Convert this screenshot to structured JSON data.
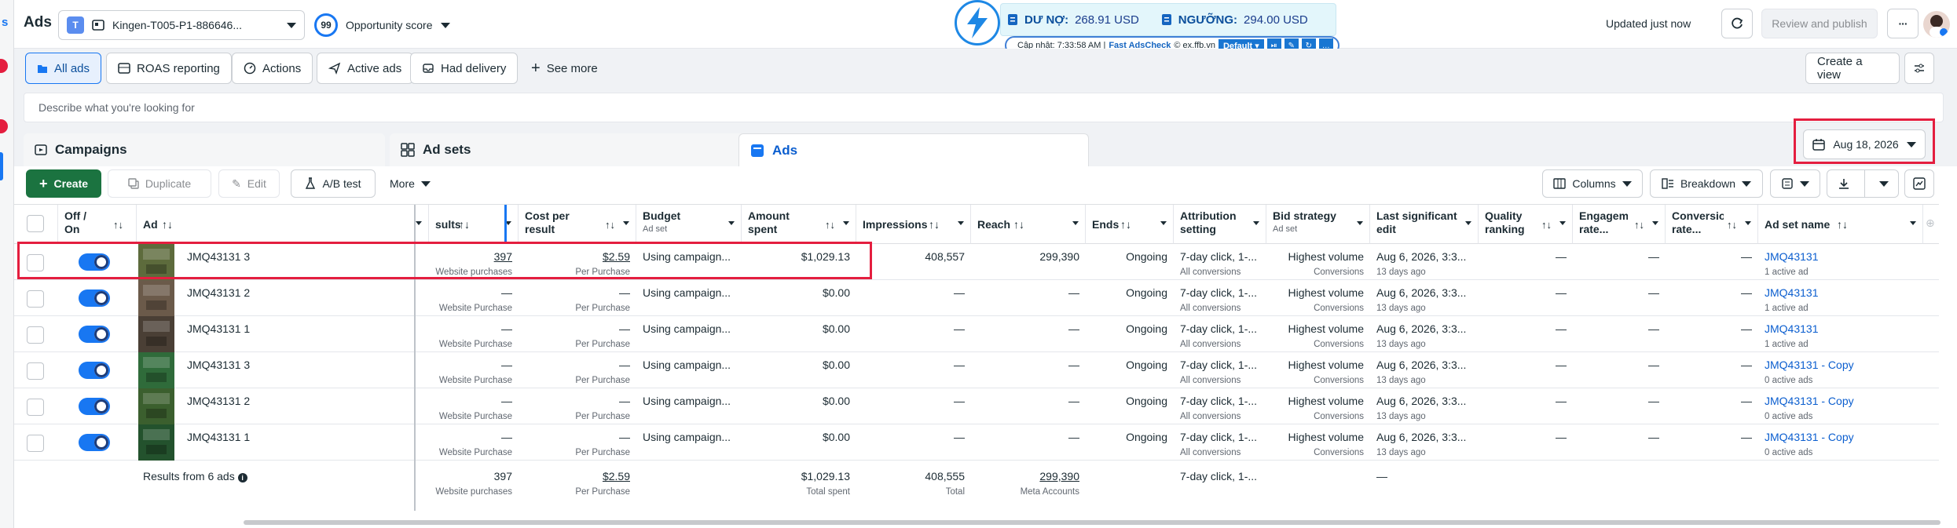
{
  "app": {
    "title": "Ads",
    "account": {
      "avatar_letter": "T",
      "name": "Kingen-T005-P1-886646..."
    },
    "opportunity": {
      "score": "99",
      "label": "Opportunity score"
    },
    "updated": "Updated just now",
    "review_publish": "Review and publish",
    "more_dots": "···"
  },
  "debt_widget": {
    "debt_label": "DƯ NỢ:",
    "debt_value": "268.91 USD",
    "threshold_label": "NGƯỠNG:",
    "threshold_value": "294.00 USD",
    "updated_text": "Cập nhật: 7:33:58 AM |",
    "brand": "Fast AdsCheck",
    "brand_suffix": "© ex.ffb.vn",
    "default_label": "Default"
  },
  "filters": {
    "pills": [
      "All ads",
      "ROAS reporting",
      "Actions",
      "Active ads",
      "Had delivery"
    ],
    "see_more": "See more",
    "create_view": "Create a view",
    "search_placeholder": "Describe what you're looking for"
  },
  "levels": {
    "campaigns": "Campaigns",
    "adsets": "Ad sets",
    "ads": "Ads",
    "date": "Aug 18, 2026"
  },
  "toolbar": {
    "create": "Create",
    "duplicate": "Duplicate",
    "edit": "Edit",
    "ab_test": "A/B test",
    "more": "More",
    "columns": "Columns",
    "breakdown": "Breakdown"
  },
  "columns": {
    "offon": "Off / On",
    "ad": "Ad",
    "results": "sults",
    "cost_per_result": "Cost per result",
    "budget": "Budget",
    "budget_sub": "Ad set",
    "amount_spent": "Amount spent",
    "impressions": "Impressions",
    "reach": "Reach",
    "ends": "Ends",
    "attribution": "Attribution setting",
    "bid_strategy": "Bid strategy",
    "bid_sub": "Ad set",
    "last_edit": "Last significant edit",
    "quality": "Quality ranking",
    "engagement": "Engagement rate...",
    "conversion": "Conversion rate...",
    "adset_name": "Ad set name"
  },
  "rows": [
    {
      "name": "JMQ43131 3",
      "results": "397",
      "results_sub": "Website purchases",
      "cpr": "$2.59",
      "cpr_sub": "Per Purchase",
      "budget": "Using campaign...",
      "spent": "$1,029.13",
      "impr": "408,557",
      "reach": "299,390",
      "ends": "Ongoing",
      "attr": "7-day click, 1-...",
      "attr_sub": "All conversions",
      "bid": "Highest volume",
      "bid_sub": "Conversions",
      "edit": "Aug 6, 2026, 3:3...",
      "edit_sub": "13 days ago",
      "quality": "—",
      "eng": "—",
      "conv": "—",
      "adset": "JMQ43131",
      "adset_sub": "1 active ad",
      "thumb": "#5d6b3c"
    },
    {
      "name": "JMQ43131 2",
      "results": "—",
      "results_sub": "Website Purchase",
      "cpr": "—",
      "cpr_sub": "Per Purchase",
      "budget": "Using campaign...",
      "spent": "$0.00",
      "impr": "—",
      "reach": "—",
      "ends": "Ongoing",
      "attr": "7-day click, 1-...",
      "attr_sub": "All conversions",
      "bid": "Highest volume",
      "bid_sub": "Conversions",
      "edit": "Aug 6, 2026, 3:3...",
      "edit_sub": "13 days ago",
      "quality": "—",
      "eng": "—",
      "conv": "—",
      "adset": "JMQ43131",
      "adset_sub": "1 active ad",
      "thumb": "#6b5a4a"
    },
    {
      "name": "JMQ43131 1",
      "results": "—",
      "results_sub": "Website Purchase",
      "cpr": "—",
      "cpr_sub": "Per Purchase",
      "budget": "Using campaign...",
      "spent": "$0.00",
      "impr": "—",
      "reach": "—",
      "ends": "Ongoing",
      "attr": "7-day click, 1-...",
      "attr_sub": "All conversions",
      "bid": "Highest volume",
      "bid_sub": "Conversions",
      "edit": "Aug 6, 2026, 3:3...",
      "edit_sub": "13 days ago",
      "quality": "—",
      "eng": "—",
      "conv": "—",
      "adset": "JMQ43131",
      "adset_sub": "1 active ad",
      "thumb": "#4a3f35"
    },
    {
      "name": "JMQ43131 3",
      "results": "—",
      "results_sub": "Website Purchase",
      "cpr": "—",
      "cpr_sub": "Per Purchase",
      "budget": "Using campaign...",
      "spent": "$0.00",
      "impr": "—",
      "reach": "—",
      "ends": "Ongoing",
      "attr": "7-day click, 1-...",
      "attr_sub": "All conversions",
      "bid": "Highest volume",
      "bid_sub": "Conversions",
      "edit": "Aug 6, 2026, 3:3...",
      "edit_sub": "13 days ago",
      "quality": "—",
      "eng": "—",
      "conv": "—",
      "adset": "JMQ43131 - Copy",
      "adset_sub": "0 active ads",
      "thumb": "#2f6b3a"
    },
    {
      "name": "JMQ43131 2",
      "results": "—",
      "results_sub": "Website Purchase",
      "cpr": "—",
      "cpr_sub": "Per Purchase",
      "budget": "Using campaign...",
      "spent": "$0.00",
      "impr": "—",
      "reach": "—",
      "ends": "Ongoing",
      "attr": "7-day click, 1-...",
      "attr_sub": "All conversions",
      "bid": "Highest volume",
      "bid_sub": "Conversions",
      "edit": "Aug 6, 2026, 3:3...",
      "edit_sub": "13 days ago",
      "quality": "—",
      "eng": "—",
      "conv": "—",
      "adset": "JMQ43131 - Copy",
      "adset_sub": "0 active ads",
      "thumb": "#3b5f2e"
    },
    {
      "name": "JMQ43131 1",
      "results": "—",
      "results_sub": "Website Purchase",
      "cpr": "—",
      "cpr_sub": "Per Purchase",
      "budget": "Using campaign...",
      "spent": "$0.00",
      "impr": "—",
      "reach": "—",
      "ends": "Ongoing",
      "attr": "7-day click, 1-...",
      "attr_sub": "All conversions",
      "bid": "Highest volume",
      "bid_sub": "Conversions",
      "edit": "Aug 6, 2026, 3:3...",
      "edit_sub": "13 days ago",
      "quality": "—",
      "eng": "—",
      "conv": "—",
      "adset": "JMQ43131 - Copy",
      "adset_sub": "0 active ads",
      "thumb": "#23522d"
    }
  ],
  "totals": {
    "label": "Results from 6 ads",
    "results": "397",
    "results_sub": "Website purchases",
    "cpr": "$2.59",
    "cpr_sub": "Per Purchase",
    "spent": "$1,029.13",
    "spent_sub": "Total spent",
    "impr": "408,555",
    "impr_sub": "Total",
    "reach": "299,390",
    "reach_sub": "Meta Accounts",
    "attr": "7-day click, 1-...",
    "quality": "—"
  },
  "colors": {
    "accent": "#1877f2",
    "create_green": "#1b7340",
    "highlight_red": "#e41e3f",
    "link": "#0b5ecf"
  }
}
